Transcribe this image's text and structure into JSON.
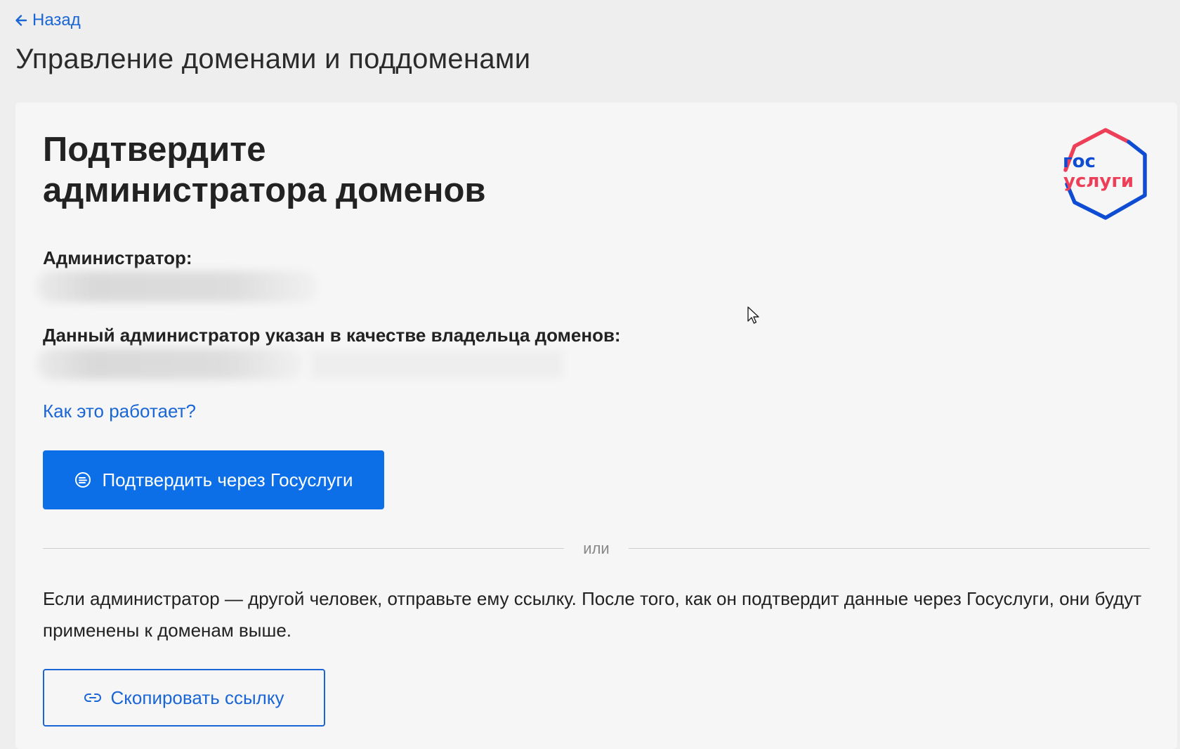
{
  "header": {
    "back_label": "Назад",
    "page_title": "Управление доменами и поддоменами"
  },
  "card": {
    "title_line1": "Подтвердите",
    "title_line2": "администратора доменов",
    "logo": {
      "line1": "гос",
      "line2": "услуги",
      "colors": {
        "blue": "#0d4cd3",
        "red": "#ee3f58"
      }
    },
    "admin_label": "Администратор:",
    "owner_label": "Данный администратор указан в качестве владельца доменов:",
    "help_link": "Как это работает?",
    "confirm_button": "Подтвердить через Госуслуги",
    "divider_text": "или",
    "info_text": "Если администратор — другой человек, отправьте ему ссылку. После того, как он подтвердит данные через Госуслуги, они будут применены к доменам выше.",
    "copy_button": "Скопировать ссылку"
  },
  "colors": {
    "accent": "#0d6fe8",
    "link": "#1a66d6",
    "page_bg": "#eeeeee",
    "card_bg": "#f6f6f6"
  },
  "icons": {
    "back": "arrow-left-icon",
    "confirm": "gosuslugi-icon",
    "copy": "link-icon",
    "cursor": "mouse-cursor-icon"
  }
}
